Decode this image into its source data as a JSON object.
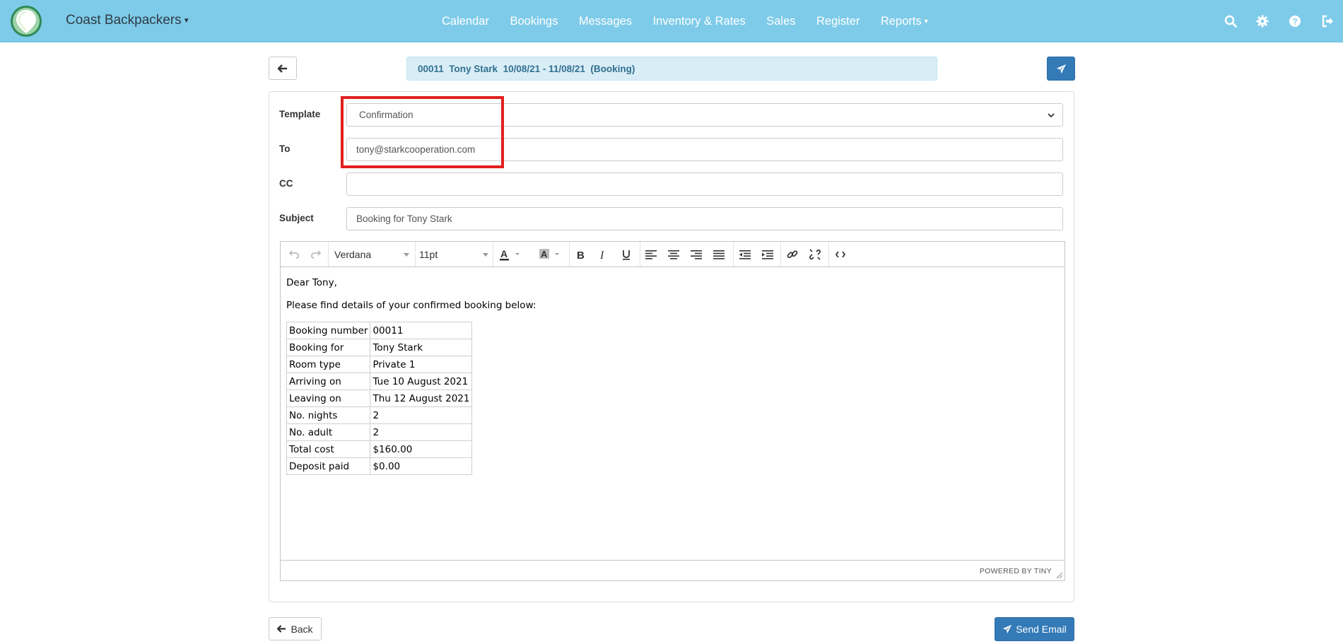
{
  "navbar": {
    "brand": "Coast Backpackers",
    "links": [
      "Calendar",
      "Bookings",
      "Messages",
      "Inventory & Rates",
      "Sales",
      "Register",
      "Reports"
    ],
    "icons": [
      "search-icon",
      "gear-icon",
      "help-icon",
      "logout-icon"
    ],
    "background": "#7ecbe9"
  },
  "header": {
    "booking_summary": "00011  Tony Stark  10/08/21 - 11/08/21  (Booking)"
  },
  "form": {
    "template_label": "Template",
    "template_value": "Confirmation",
    "to_label": "To",
    "to_value": "tony@starkcooperation.com",
    "cc_label": "CC",
    "cc_value": "",
    "subject_label": "Subject",
    "subject_value": "Booking for Tony Stark"
  },
  "editor": {
    "font_family": "Verdana",
    "font_size": "11pt",
    "greeting": "Dear Tony,",
    "intro": "Please find details of your confirmed booking below:",
    "rows": [
      {
        "label": "Booking number",
        "value": "00011"
      },
      {
        "label": "Booking for",
        "value": "Tony Stark"
      },
      {
        "label": "Room type",
        "value": "Private 1"
      },
      {
        "label": "Arriving on",
        "value": "Tue 10 August 2021"
      },
      {
        "label": "Leaving on",
        "value": "Thu 12 August 2021"
      },
      {
        "label": "No. nights",
        "value": "2"
      },
      {
        "label": "No. adult",
        "value": "2"
      },
      {
        "label": "Total cost",
        "value": "$160.00"
      },
      {
        "label": "Deposit paid",
        "value": "$0.00"
      }
    ],
    "powered_by": "POWERED BY TINY"
  },
  "footer": {
    "back_label": "Back",
    "send_label": "Send Email"
  },
  "colors": {
    "primary": "#337ab7",
    "highlight": "#e0201e",
    "banner": "#d9edf7"
  }
}
